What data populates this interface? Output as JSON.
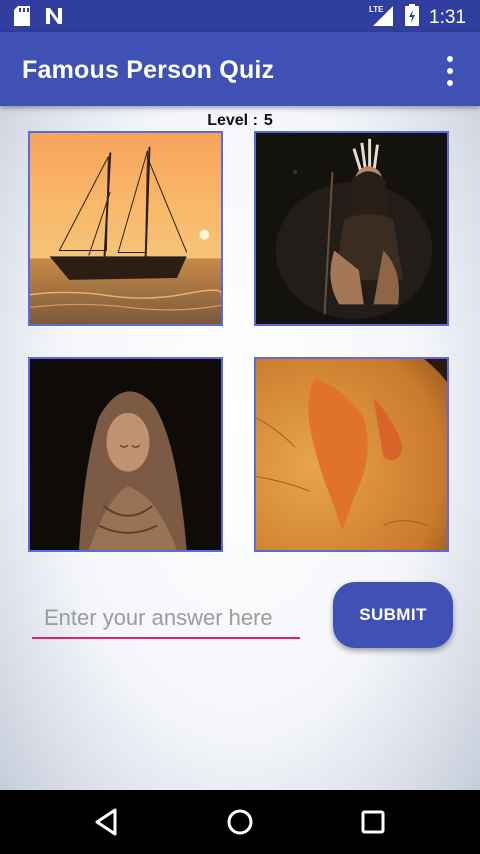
{
  "status_bar": {
    "time": "1:31",
    "network_label": "LTE",
    "icons": [
      "sd-card-icon",
      "n-logo-icon",
      "lte-signal-icon",
      "battery-icon"
    ]
  },
  "app_bar": {
    "title": "Famous Person Quiz",
    "menu_icon": "more-vert-icon"
  },
  "quiz": {
    "level_label": "Level :",
    "level_value": "5",
    "images": [
      {
        "name": "sailing-ship-sunset-image"
      },
      {
        "name": "native-woman-headdress-image"
      },
      {
        "name": "madonna-statue-image"
      },
      {
        "name": "globe-india-image"
      }
    ]
  },
  "answer": {
    "placeholder": "Enter your answer here",
    "value": ""
  },
  "submit": {
    "label": "SUBMIT"
  },
  "nav_bar": {
    "icons": [
      "back-icon",
      "home-icon",
      "recents-icon"
    ]
  },
  "colors": {
    "primary": "#3f51b5",
    "primary_dark": "#303f9f",
    "accent": "#e91e63"
  }
}
